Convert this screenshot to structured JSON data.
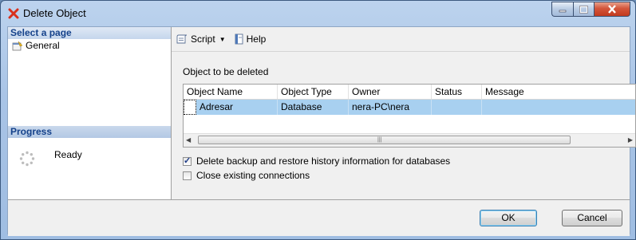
{
  "window": {
    "title": "Delete Object"
  },
  "left_panel": {
    "select_page_header": "Select a page",
    "pages": [
      {
        "label": "General"
      }
    ],
    "progress_header": "Progress",
    "progress_status": "Ready"
  },
  "toolbar": {
    "script_label": "Script",
    "help_label": "Help"
  },
  "main": {
    "section_label": "Object to be deleted",
    "grid": {
      "columns": [
        "Object Name",
        "Object Type",
        "Owner",
        "Status",
        "Message"
      ],
      "rows": [
        {
          "name": "Adresar",
          "type": "Database",
          "owner": "nera-PC\\nera",
          "status": "",
          "message": ""
        }
      ]
    },
    "options": [
      {
        "label": "Delete backup and restore history information for databases",
        "checked": true
      },
      {
        "label": "Close existing connections",
        "checked": false
      }
    ]
  },
  "buttons": {
    "ok": "OK",
    "cancel": "Cancel"
  },
  "colors": {
    "selection_row": "#a8d0f0",
    "header_blue": "#15428b",
    "close_button": "#c23a1e"
  }
}
